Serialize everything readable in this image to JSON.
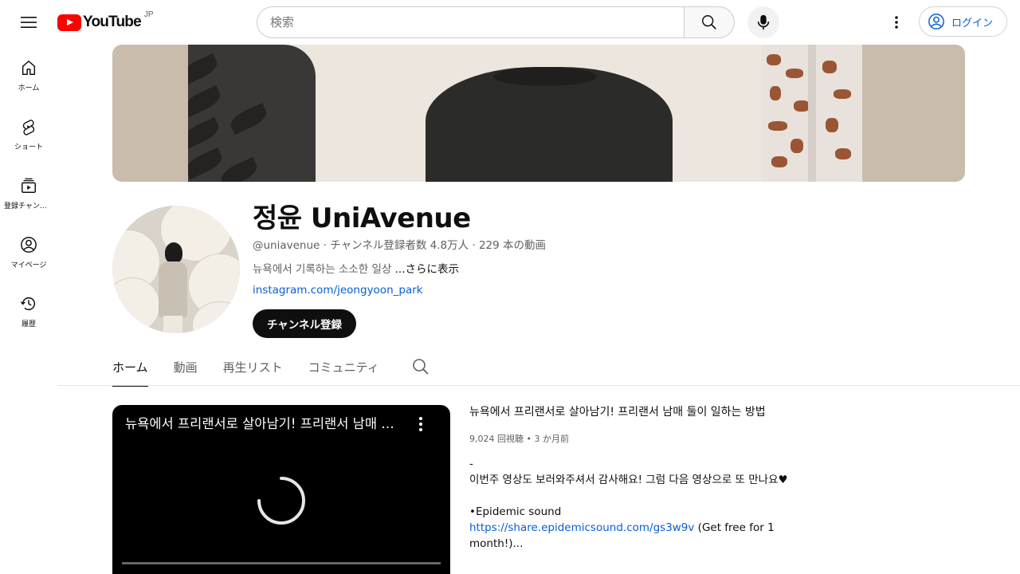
{
  "header": {
    "logo_text": "YouTube",
    "country": "JP",
    "search_placeholder": "検索",
    "login_label": "ログイン"
  },
  "leftnav": {
    "items": [
      {
        "label": "ホーム",
        "icon": "home-icon"
      },
      {
        "label": "ショート",
        "icon": "shorts-icon"
      },
      {
        "label": "登録チャンネル",
        "icon": "subscriptions-icon"
      },
      {
        "label": "マイページ",
        "icon": "you-icon"
      },
      {
        "label": "履歴",
        "icon": "history-icon"
      }
    ]
  },
  "channel": {
    "name": "정윤 UniAvenue",
    "handle": "@uniavenue",
    "subscribers": "チャンネル登録者数 4.8万人",
    "videos": "229 本の動画",
    "meta_sep": " ‧ ",
    "description": "뉴욕에서 기록하는 소소한 일상 ",
    "more_label": "...さらに表示",
    "link": "instagram.com/jeongyoon_park",
    "subscribe_label": "チャンネル登録"
  },
  "tabs": [
    {
      "label": "ホーム",
      "active": true
    },
    {
      "label": "動画",
      "active": false
    },
    {
      "label": "再生リスト",
      "active": false
    },
    {
      "label": "コミュニティ",
      "active": false
    }
  ],
  "featured": {
    "player_title": "뉴욕에서 프리랜서로 살아남기! 프리랜서 남매 둘이 일하는 방법",
    "title": "뉴욕에서 프리랜서로 살아남기! 프리랜서 남매 둘이 일하는 방법",
    "views": "9,024 回視聴",
    "stats_sep": " • ",
    "age": "3 か月前",
    "desc_line1": "-",
    "desc_line2": "이번주 영상도 보러와주셔서 감사해요! 그럼 다음 영상으로 또 만나요♥",
    "desc_line3": "•Epidemic sound",
    "desc_link": "https://share.epidemicsound.com/gs3w9v",
    "desc_link_after": " (Get free for 1 month!)..."
  },
  "colors": {
    "brand_red": "#ff0000",
    "link_blue": "#065fd4",
    "text_primary": "#0f0f0f",
    "text_secondary": "#606060"
  }
}
